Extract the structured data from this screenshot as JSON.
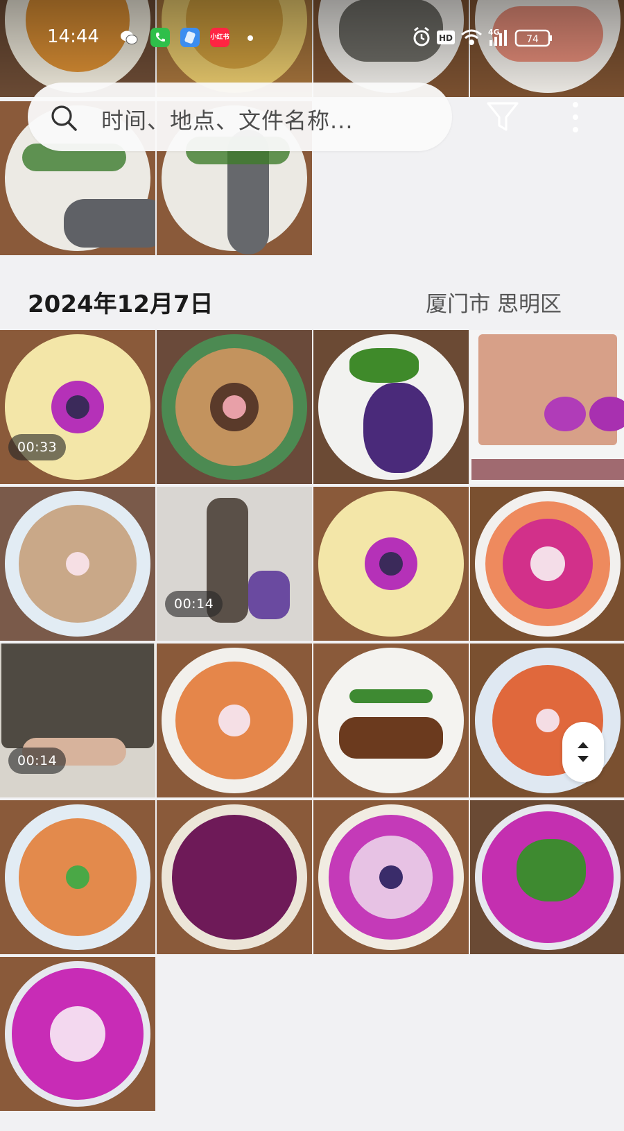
{
  "status_bar": {
    "time": "14:44",
    "app_icons": [
      "wechat-icon",
      "phone-icon",
      "blue-app-icon",
      "xiaohongshu-icon"
    ],
    "xiaohongshu_label": "小红书",
    "network_hd": "HD",
    "network_type": "4G",
    "battery": "74"
  },
  "search": {
    "placeholder": "时间、地点、文件名称..."
  },
  "section": {
    "date": "2024年12月7日",
    "location": "厦门市 思明区"
  },
  "videos": {
    "duration_1": "00:33",
    "duration_2": "00:14",
    "duration_3": "00:14"
  },
  "colors": {
    "background": "#f1f1f3",
    "accent_purple": "#c02eb4",
    "duration_badge": "#3a3a3a"
  }
}
